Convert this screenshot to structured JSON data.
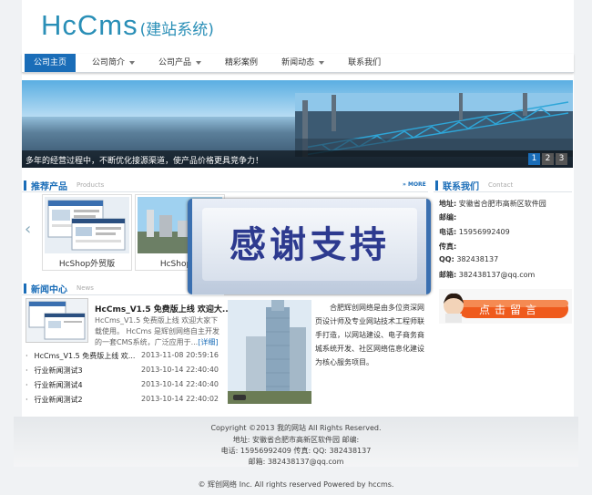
{
  "logo": {
    "en": "HcCms",
    "cn": "(建站系统)"
  },
  "nav": [
    {
      "label": "公司主页",
      "active": true,
      "has_menu": false
    },
    {
      "label": "公司简介",
      "active": false,
      "has_menu": true
    },
    {
      "label": "公司产品",
      "active": false,
      "has_menu": true
    },
    {
      "label": "精彩案例",
      "active": false,
      "has_menu": false
    },
    {
      "label": "新闻动态",
      "active": false,
      "has_menu": true
    },
    {
      "label": "联系我们",
      "active": false,
      "has_menu": false
    }
  ],
  "banner": {
    "caption": "多年的经营过程中，不断优化接源渠道，使产品价格更具竞争力！",
    "pages": [
      "1",
      "2",
      "3"
    ],
    "active_page": "1"
  },
  "products": {
    "title": "推荐产品",
    "title_en": "Products",
    "more": "MORE",
    "items": [
      {
        "label": "HcShop外贸版"
      },
      {
        "label": "HcShop中"
      }
    ]
  },
  "overlay": {
    "text": "感谢支持"
  },
  "contact": {
    "title": "联系我们",
    "title_en": "Contact",
    "address_label": "地址:",
    "address": "安徽省合肥市高新区软件园",
    "zip_label": "邮编:",
    "zip": "",
    "phone_label": "电话:",
    "phone": "15956992409",
    "fax_label": "传真:",
    "fax": "",
    "qq_label": "QQ:",
    "qq": "382438137",
    "email_label": "邮箱:",
    "email": "382438137@qq.com",
    "message_button": "点击留言"
  },
  "news": {
    "title": "新闻中心",
    "title_en": "News",
    "featured": {
      "title": "HcCms_V1.5 免费版上线 欢迎大...",
      "desc": "HcCms_V1.5 免费版上线 欢迎大家下载使用。 HcCms 是辉创网络自主开发的一套CMS系统，广泛应用于...",
      "more": "[详细]"
    },
    "rows": [
      {
        "title": "HcCms_V1.5 免费版上线 欢...",
        "date": "2013-11-08 20:59:16"
      },
      {
        "title": "行业新闻测试3",
        "date": "2013-10-14 22:40:40"
      },
      {
        "title": "行业新闻测试4",
        "date": "2013-10-14 22:40:40"
      },
      {
        "title": "行业新闻测试2",
        "date": "2013-10-14 22:40:02"
      }
    ],
    "about": "合肥辉创网络是由多位资深网页设计师及专业网站技术工程师联手打造，以网站建设、电子商务商城系统开发、社区网络信息化建设为核心服务项目。"
  },
  "footer": {
    "copyright": "Copyright ©2013 我的网站 All Rights Reserved.",
    "address": "地址: 安徽省合肥市高新区软件园    邮编:",
    "phone_qq": "电话: 15956992409    传真:    QQ: 382438137",
    "email": "邮箱: 382438137@qq.com",
    "powered": "© 辉创网络 Inc. All rights reserved Powered by hccms."
  }
}
